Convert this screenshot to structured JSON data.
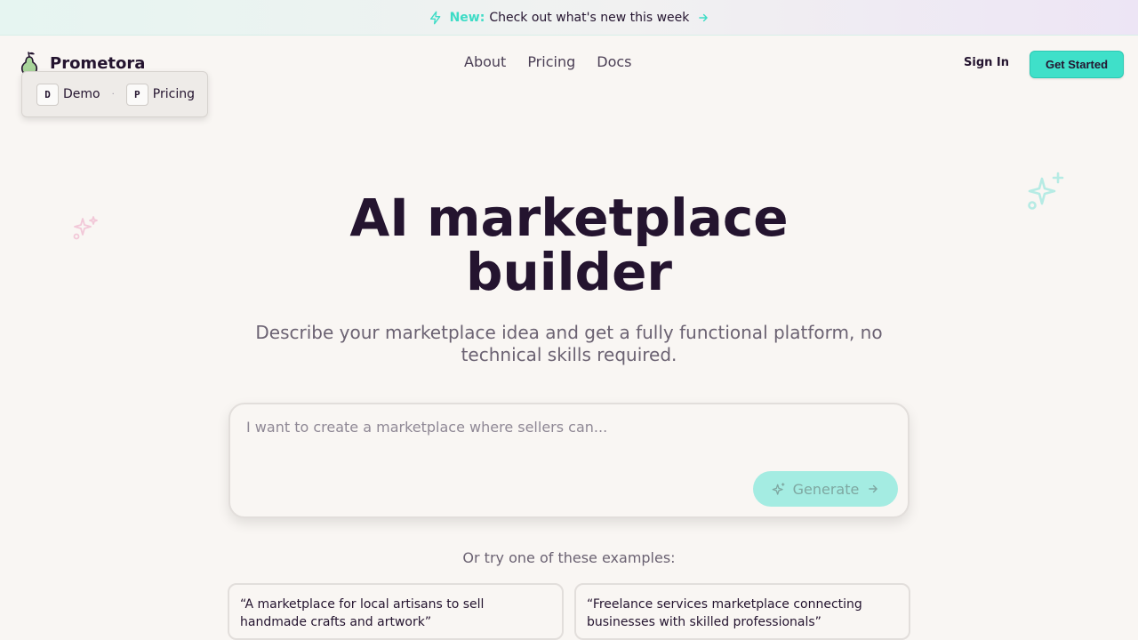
{
  "banner": {
    "new_label": "New:",
    "message": "Check out what's new this week"
  },
  "header": {
    "brand": "Prometora",
    "nav": [
      "About",
      "Pricing",
      "Docs"
    ],
    "sign_in": "Sign In",
    "get_started": "Get Started"
  },
  "shortcuts": {
    "items": [
      {
        "key": "D",
        "label": "Demo"
      },
      {
        "key": "P",
        "label": "Pricing"
      }
    ],
    "separator": "·"
  },
  "hero": {
    "title_line1": "AI marketplace",
    "title_line2": "builder",
    "subtitle": "Describe your marketplace idea and get a fully functional platform, no technical skills required."
  },
  "prompt": {
    "placeholder": "I want to create a marketplace where sellers can...",
    "value": "",
    "generate_label": "Generate"
  },
  "examples": {
    "heading": "Or try one of these examples:",
    "items": [
      "“A marketplace for local artisans to sell handmade crafts and artwork”",
      "“Freelance services marketplace connecting businesses with skilled professionals”"
    ]
  },
  "icons": {
    "banner": "bolt-icon",
    "banner_arrow": "arrow-right-icon",
    "logo": "pear-icon",
    "generate": "sparkles-icon",
    "decoration": "sparkles-icon"
  },
  "colors": {
    "accent": "#3fe0c9",
    "accent_disabled": "#a4ece2",
    "text": "#24142f",
    "muted": "#6b6272",
    "background": "#f9f6f3"
  }
}
